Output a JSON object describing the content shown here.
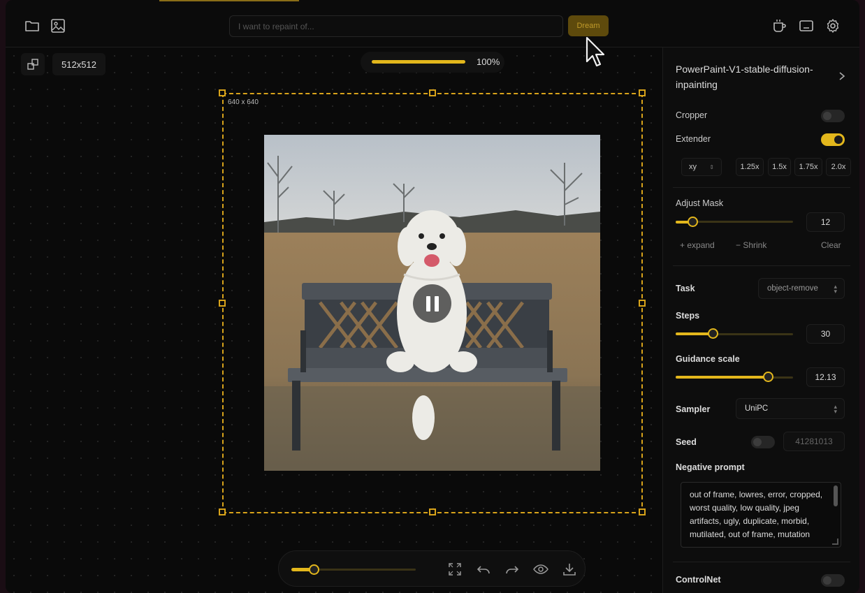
{
  "toolbar": {
    "prompt_placeholder": "I want to repaint of...",
    "dream_label": "Dream",
    "icons": [
      "folder-icon",
      "image-icon",
      "coffee-icon",
      "keyboard-icon",
      "gear-icon"
    ]
  },
  "canvas": {
    "size_label": "512x512",
    "zoom_label": "100%",
    "zoom_value": 1.0,
    "extender_size_label": "640 x 640",
    "brush_size_fraction": 0.18
  },
  "panel": {
    "model_name": "PowerPaint-V1-stable-diffusion-inpainting",
    "cropper_label": "Cropper",
    "cropper_on": false,
    "extender_label": "Extender",
    "extender_on": true,
    "direction_value": "xy",
    "scale_options": [
      "1.25x",
      "1.5x",
      "1.75x",
      "2.0x"
    ],
    "adjust_mask_label": "Adjust Mask",
    "adjust_mask_value": "12",
    "expand_label": "+ expand",
    "shrink_label": "− Shrink",
    "clear_label": "Clear",
    "task_label": "Task",
    "task_value": "object-remove",
    "steps_label": "Steps",
    "steps_value": "30",
    "guidance_label": "Guidance scale",
    "guidance_value": "12.13",
    "sampler_label": "Sampler",
    "sampler_value": "UniPC",
    "seed_label": "Seed",
    "seed_on": false,
    "seed_value": "41281013",
    "negative_prompt_label": "Negative prompt",
    "negative_prompt_value": "out of frame, lowres, error, cropped, worst quality, low quality, jpeg artifacts, ugly, duplicate, morbid, mutilated, out of frame, mutation",
    "controlnet_label": "ControlNet",
    "controlnet_on": false
  },
  "colors": {
    "accent": "#e3b71c",
    "background": "#0b0b0b",
    "panel": "#0d0d0d"
  }
}
